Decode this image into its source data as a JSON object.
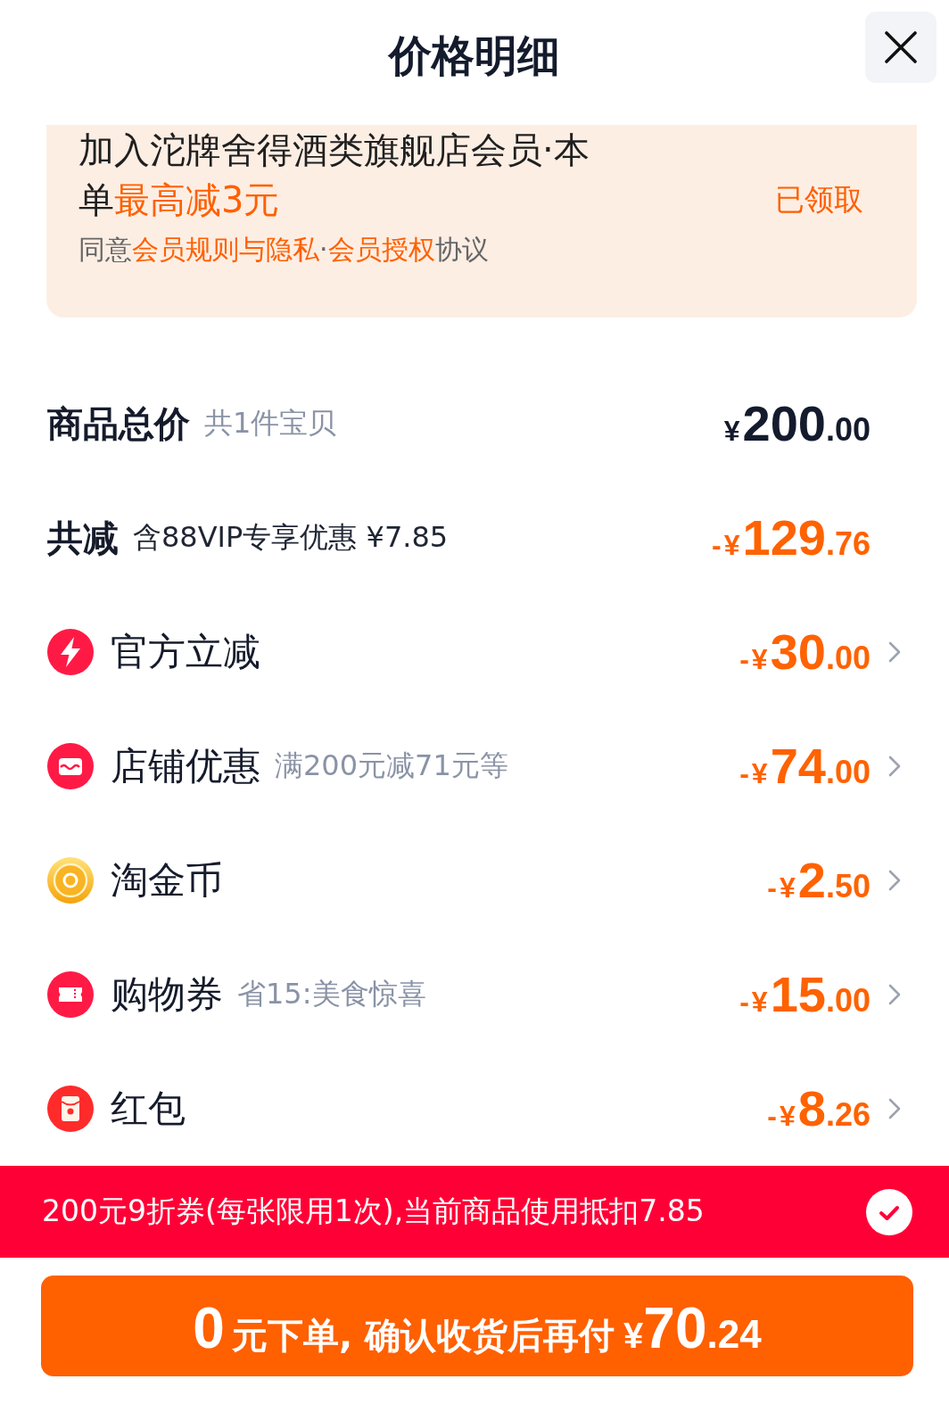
{
  "header": {
    "title": "价格明细"
  },
  "member_card": {
    "text": "加入沱牌舍得酒类旗舰店会员·本单**最高减3元**",
    "status": "已领取",
    "agreement": [
      {
        "kind": "plain",
        "text": "同意"
      },
      {
        "kind": "link",
        "text": "会员规则与隐私"
      },
      {
        "kind": "plain",
        "text": "·"
      },
      {
        "kind": "link",
        "text": "会员授权"
      },
      {
        "kind": "plain",
        "text": "协议"
      }
    ]
  },
  "rows": [
    {
      "kind": "total",
      "label": "商品总价",
      "note": "共1件宝贝",
      "amount": {
        "prefix": "¥",
        "integer": "200",
        "decimal": ".00"
      }
    },
    {
      "kind": "summary",
      "label": "共减",
      "note": "含88VIP专享优惠 ¥7.85",
      "amount": {
        "prefix": "-¥",
        "integer": "129",
        "decimal": ".76"
      }
    },
    {
      "kind": "official",
      "label": "官方立减",
      "amount": {
        "prefix": "-¥",
        "integer": "30",
        "decimal": ".00"
      }
    },
    {
      "kind": "store",
      "label": "店铺优惠",
      "note": "满200元减71元等",
      "amount": {
        "prefix": "-¥",
        "integer": "74",
        "decimal": ".00"
      }
    },
    {
      "kind": "coins",
      "label": "淘金币",
      "amount": {
        "prefix": "-¥",
        "integer": "2",
        "decimal": ".50"
      }
    },
    {
      "kind": "coupon",
      "label": "购物券",
      "note": "省15:美食惊喜",
      "amount": {
        "prefix": "-¥",
        "integer": "15",
        "decimal": ".00"
      }
    },
    {
      "kind": "red_packet",
      "label": "红包",
      "amount": {
        "prefix": "-¥",
        "integer": "8",
        "decimal": ".26"
      }
    }
  ],
  "banner": {
    "text": "200元9折券(每张限用1次),当前商品使用抵扣7.85",
    "checked": true
  },
  "pay_button": {
    "lead": "0",
    "text": "元下单, 确认收货后再付",
    "currency": "¥",
    "integer": "70",
    "decimal": ".24"
  }
}
